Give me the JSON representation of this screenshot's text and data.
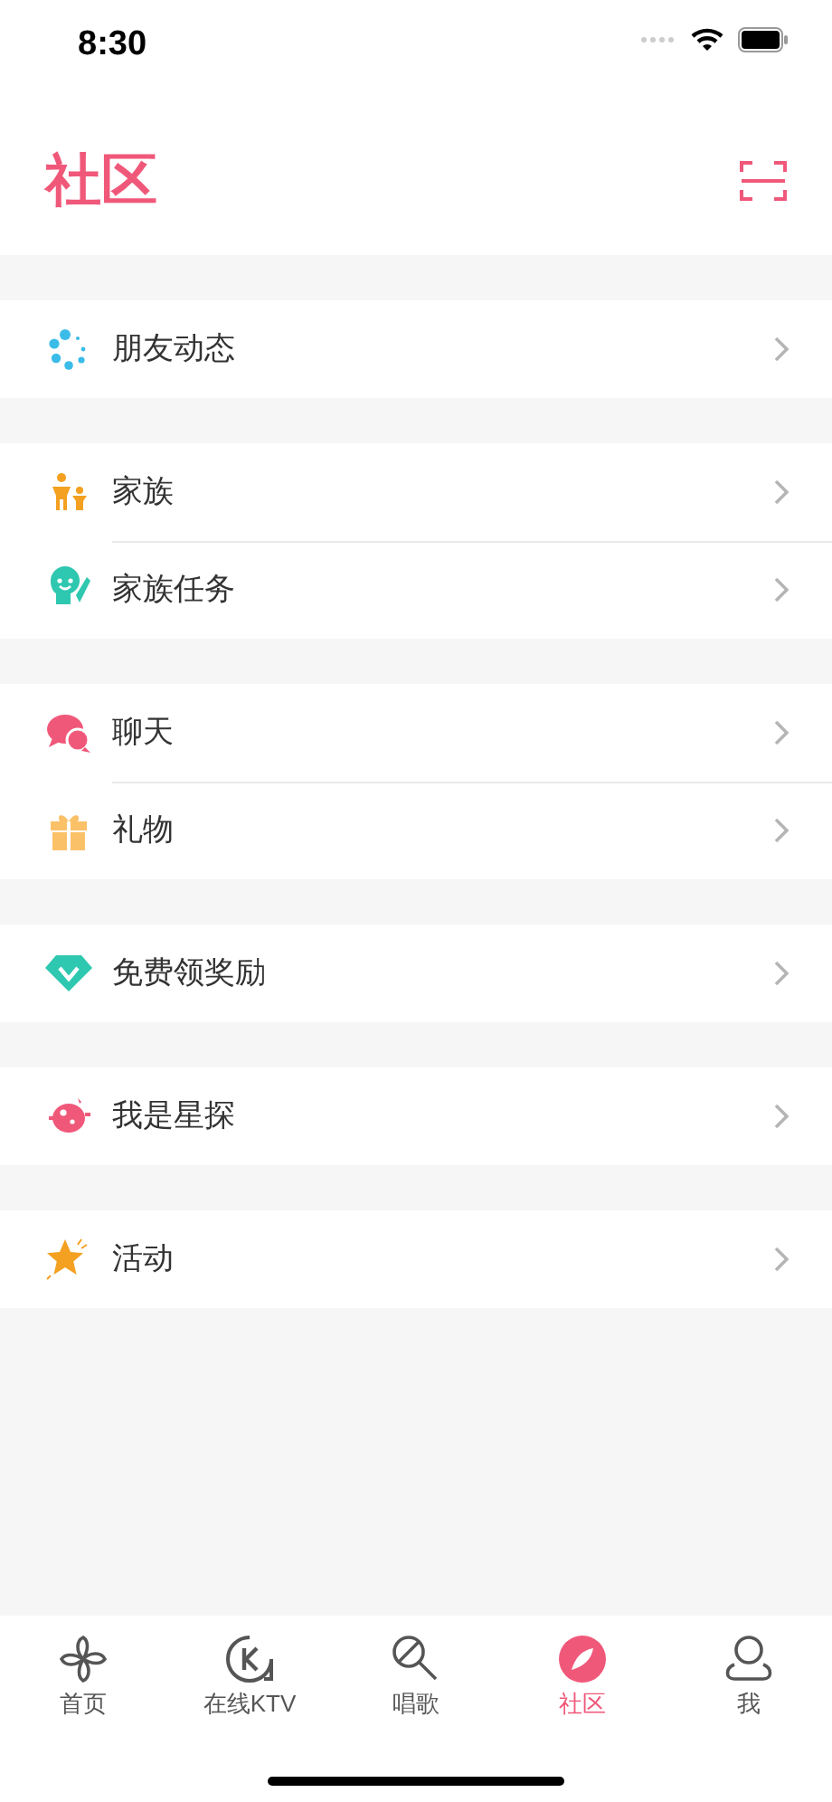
{
  "status_bar": {
    "time": "8:30"
  },
  "header": {
    "title": "社区"
  },
  "groups": [
    {
      "items": [
        {
          "label": "朋友动态",
          "kind": "dots"
        }
      ]
    },
    {
      "items": [
        {
          "label": "家族",
          "kind": "family"
        },
        {
          "label": "家族任务",
          "kind": "task"
        }
      ]
    },
    {
      "items": [
        {
          "label": "聊天",
          "kind": "chat"
        },
        {
          "label": "礼物",
          "kind": "gift"
        }
      ]
    },
    {
      "items": [
        {
          "label": "免费领奖励",
          "kind": "gem"
        }
      ]
    },
    {
      "items": [
        {
          "label": "我是星探",
          "kind": "planet"
        }
      ]
    },
    {
      "items": [
        {
          "label": "活动",
          "kind": "star"
        }
      ]
    }
  ],
  "tabs": [
    {
      "label": "首页",
      "kind": "pinwheel",
      "selected": false
    },
    {
      "label": "在线KTV",
      "kind": "ktv",
      "selected": false
    },
    {
      "label": "唱歌",
      "kind": "mic",
      "selected": false
    },
    {
      "label": "社区",
      "kind": "feather",
      "selected": true
    },
    {
      "label": "我",
      "kind": "person",
      "selected": false
    }
  ]
}
